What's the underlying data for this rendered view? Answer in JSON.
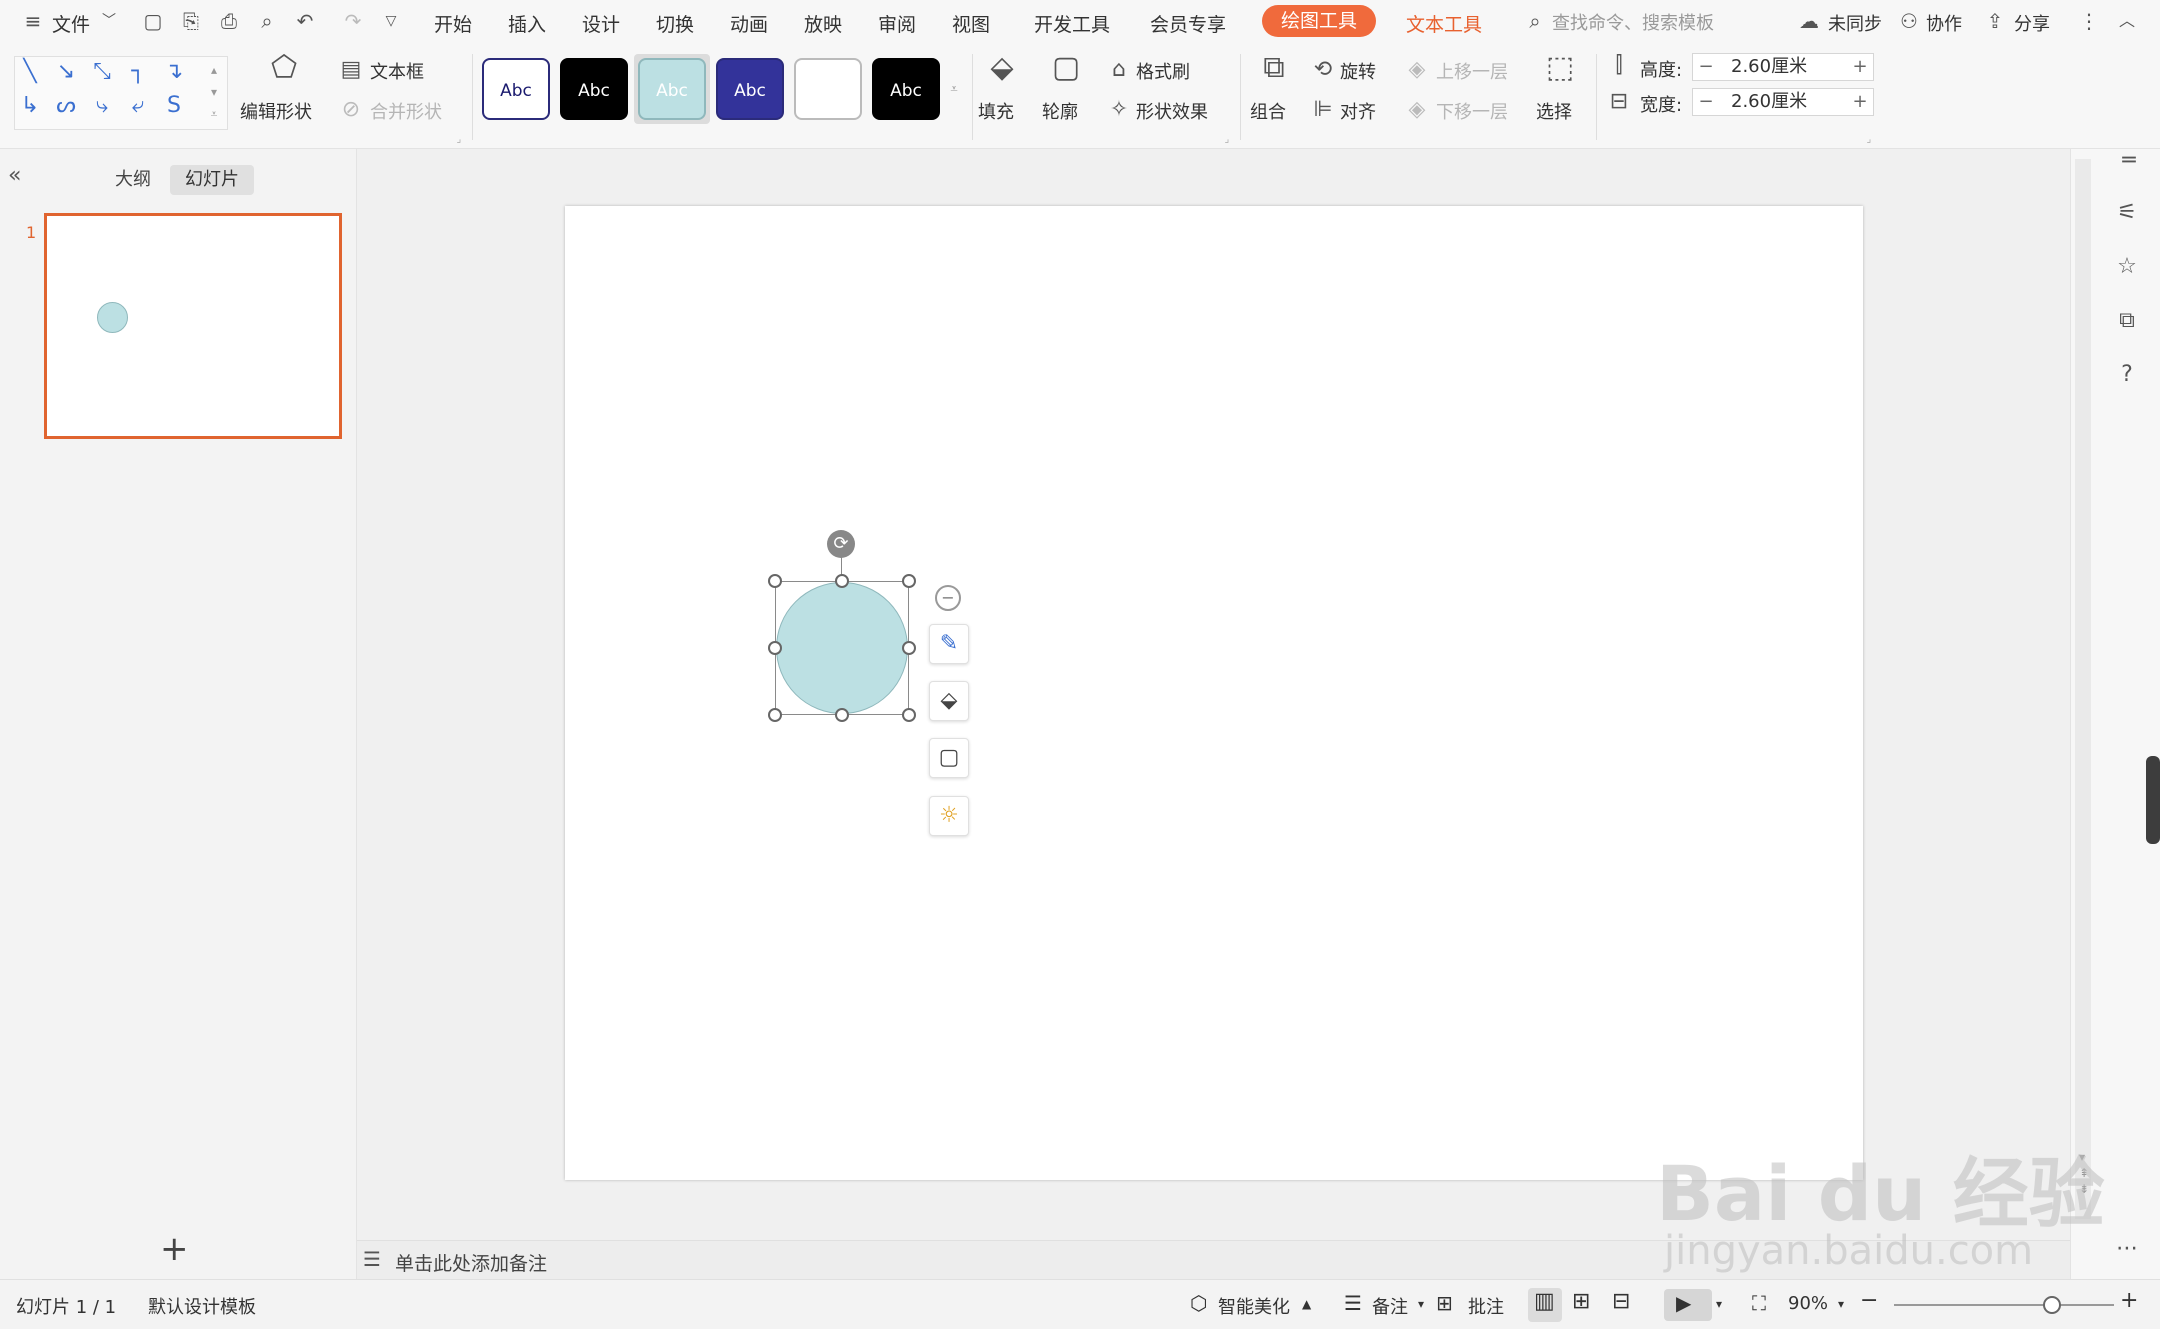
{
  "menubar": {
    "file_label": "文件",
    "tabs": [
      "开始",
      "插入",
      "设计",
      "切换",
      "动画",
      "放映",
      "审阅",
      "视图",
      "开发工具",
      "会员专享"
    ],
    "active_tab": "绘图工具",
    "text_tool_tab": "文本工具",
    "search_placeholder": "查找命令、搜索模板",
    "sync_label": "未同步",
    "collab_label": "协作",
    "share_label": "分享"
  },
  "ribbon": {
    "edit_shape": "编辑形状",
    "text_box": "文本框",
    "merge_shape": "合并形状",
    "styles": [
      {
        "label": "Abc",
        "bg": "#ffffff",
        "fg": "#1a1a6e",
        "border": "#2b2b7a"
      },
      {
        "label": "Abc",
        "bg": "#000000",
        "fg": "#ffffff",
        "border": "#000000"
      },
      {
        "label": "Abc",
        "bg": "#bce0e3",
        "fg": "#ffffff",
        "border": "#8fb8bc"
      },
      {
        "label": "Abc",
        "bg": "#33339a",
        "fg": "#ffffff",
        "border": "#2b2b7a"
      },
      {
        "label": "",
        "bg": "#ffffff",
        "fg": "#ffffff",
        "border": "#bbbbbb"
      },
      {
        "label": "Abc",
        "bg": "#000000",
        "fg": "#ffffff",
        "border": "#000000"
      }
    ],
    "fill": "填充",
    "outline": "轮廓",
    "format_painter": "格式刷",
    "shape_effects": "形状效果",
    "group": "组合",
    "rotate": "旋转",
    "align": "对齐",
    "bring_forward": "上移一层",
    "send_backward": "下移一层",
    "select": "选择",
    "height_label": "高度:",
    "height_value": "2.60厘米",
    "width_label": "宽度:",
    "width_value": "2.60厘米"
  },
  "left_panel": {
    "outline_tab": "大纲",
    "slides_tab": "幻灯片",
    "slide_number": "1",
    "add_slide": "+"
  },
  "notes": {
    "placeholder": "单击此处添加备注"
  },
  "status": {
    "slide_info": "幻灯片 1 / 1",
    "template": "默认设计模板",
    "smart_beautify": "智能美化",
    "notes_label": "备注",
    "comments_label": "批注",
    "zoom": "90%",
    "zoom_fraction": 0.72
  },
  "shape": {
    "fill": "#bce0e3",
    "stroke": "#8fb8bc"
  },
  "watermark": {
    "brand": "Bai du 经验",
    "url": "jingyan.baidu.com"
  },
  "colors": {
    "accent": "#f06a3c",
    "selection_border": "#e0642f"
  }
}
